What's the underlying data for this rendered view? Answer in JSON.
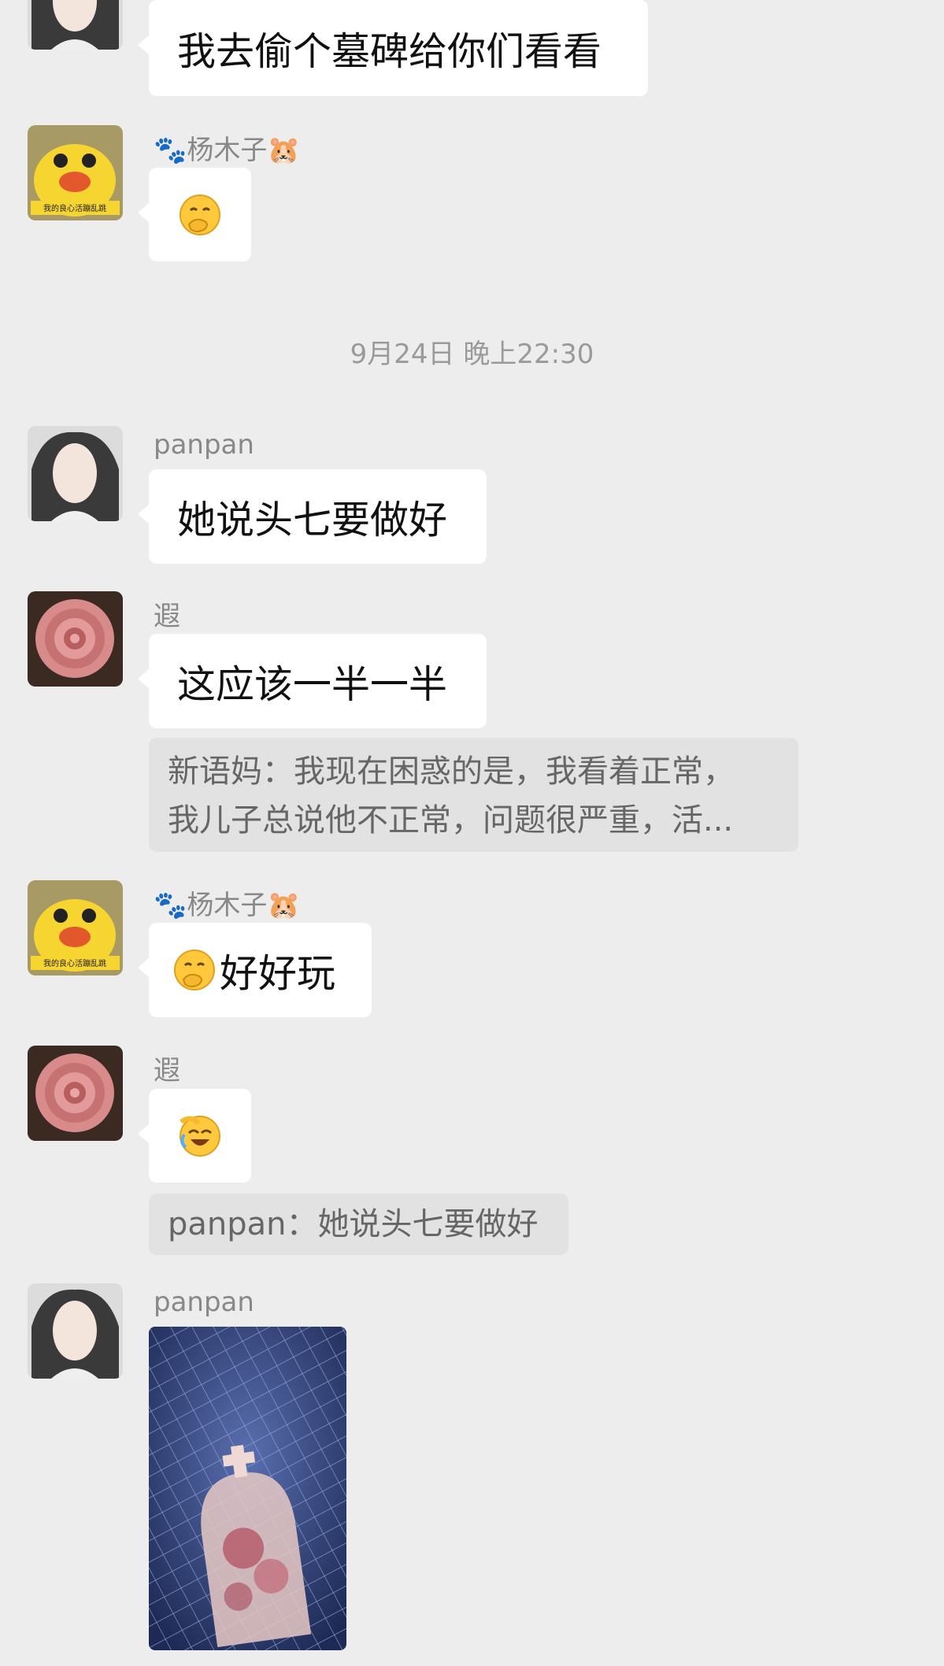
{
  "messages": [
    {
      "text": "我去偷个墓碑给你们看看"
    },
    {
      "sender": "🐾杨木子🐹",
      "emoji": "hand-over-mouth-emoji"
    },
    {
      "sender": "panpan",
      "text": "她说头七要做好"
    },
    {
      "sender": "遐",
      "text": "这应该一半一半",
      "quote": [
        "新语妈：我现在困惑的是，我看着正常，",
        "我儿子总说他不正常，问题很严重，活..."
      ]
    },
    {
      "sender": "🐾杨木子🐹",
      "emoji": "hand-over-mouth-emoji",
      "text": "好好玩"
    },
    {
      "sender": "遐",
      "emoji": "laughing-crying-emoji",
      "quote_text": "panpan：她说头七要做好"
    },
    {
      "sender": "panpan",
      "image": "tombstone-photo"
    }
  ],
  "timestamp": "9月24日 晚上22:30",
  "avatar_duck_caption": "我的良心活蹦乱跳",
  "colors": {
    "background": "#ededed",
    "bubble": "#ffffff",
    "quote": "#e2e2e2",
    "mat": "#3d4f8a"
  }
}
